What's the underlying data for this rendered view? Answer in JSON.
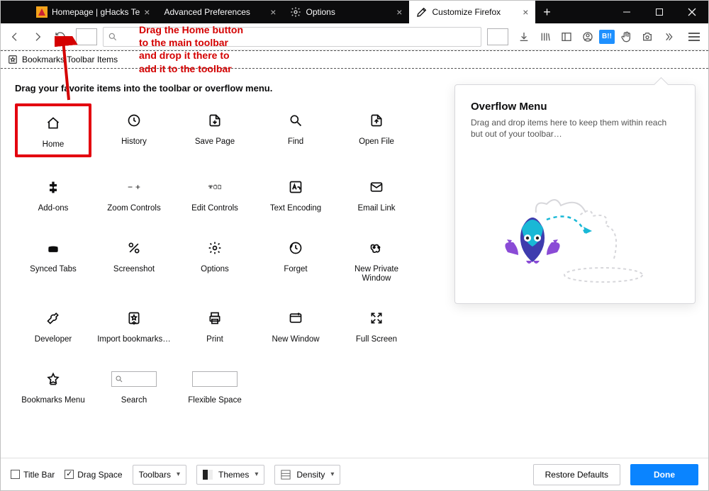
{
  "tabs": [
    {
      "label": "Homepage | gHacks Te"
    },
    {
      "label": "Advanced Preferences"
    },
    {
      "label": "Options"
    },
    {
      "label": "Customize Firefox"
    }
  ],
  "bookmarks_toolbar_label": "Bookmarks Toolbar Items",
  "annotation": {
    "l1": "Drag the Home button",
    "l2": "to the main toolbar",
    "l3": "and drop it there to",
    "l4": "add it to the toolbar"
  },
  "instruction": "Drag your favorite items into the toolbar or overflow menu.",
  "tiles": {
    "home": "Home",
    "history": "History",
    "save_page": "Save Page",
    "find": "Find",
    "open_file": "Open File",
    "addons": "Add-ons",
    "zoom": "Zoom Controls",
    "edit": "Edit Controls",
    "text_encoding": "Text Encoding",
    "email": "Email Link",
    "synced": "Synced Tabs",
    "screenshot": "Screenshot",
    "options": "Options",
    "forget": "Forget",
    "private": "New Private Window",
    "developer": "Developer",
    "import_bm": "Import bookmarks…",
    "print": "Print",
    "new_window": "New Window",
    "full_screen": "Full Screen",
    "bm_menu": "Bookmarks Menu",
    "search": "Search",
    "flex": "Flexible Space"
  },
  "overflow": {
    "title": "Overflow Menu",
    "desc": "Drag and drop items here to keep them within reach but out of your toolbar…"
  },
  "footer": {
    "title_bar": "Title Bar",
    "drag_space": "Drag Space",
    "toolbars": "Toolbars",
    "themes": "Themes",
    "density": "Density",
    "restore": "Restore Defaults",
    "done": "Done"
  },
  "badge_bii": "B!!"
}
